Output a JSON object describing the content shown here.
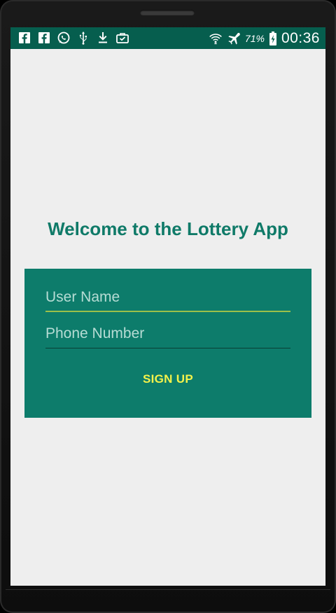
{
  "status_bar": {
    "left_icons": [
      "facebook-icon",
      "facebook-icon",
      "whatsapp-icon",
      "usb-icon",
      "download-icon",
      "work-bag-icon"
    ],
    "right_icons": [
      "wifi-icon",
      "airplane-mode-icon",
      "battery-charging-icon"
    ],
    "battery_percent": "71%",
    "time": "00:36",
    "background_color": "#065e4e"
  },
  "screen": {
    "title": "Welcome to the Lottery App",
    "background_color": "#eeeeee"
  },
  "form": {
    "background_color": "#0d7c6b",
    "username": {
      "placeholder": "User Name",
      "value": ""
    },
    "phone": {
      "placeholder": "Phone Number",
      "value": ""
    },
    "signup_label": "SIGN UP",
    "signup_color": "#f4f24a",
    "active_underline_color": "#9cc04a"
  }
}
